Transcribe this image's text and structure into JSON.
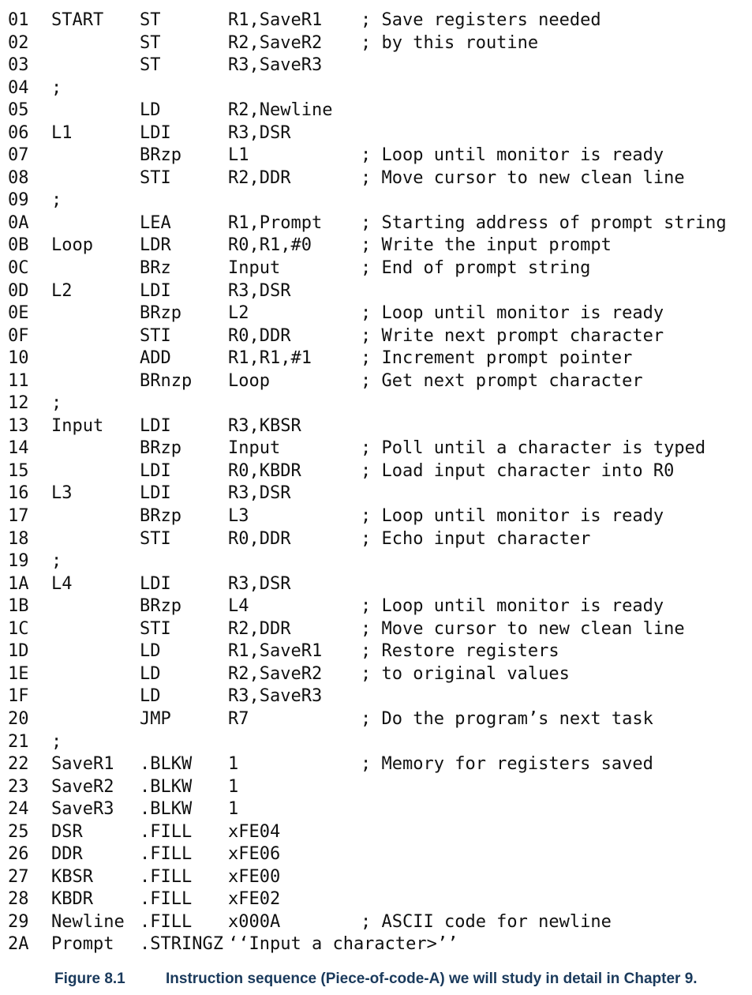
{
  "lines": [
    {
      "num": "01",
      "label": "START",
      "op": "ST",
      "operand": "R1,SaveR1",
      "comment": "; Save registers needed"
    },
    {
      "num": "02",
      "label": "",
      "op": "ST",
      "operand": "R2,SaveR2",
      "comment": "; by this routine"
    },
    {
      "num": "03",
      "label": "",
      "op": "ST",
      "operand": "R3,SaveR3",
      "comment": ""
    },
    {
      "num": "04",
      "label": ";",
      "op": "",
      "operand": "",
      "comment": ""
    },
    {
      "num": "05",
      "label": "",
      "op": "LD",
      "operand": "R2,Newline",
      "comment": ""
    },
    {
      "num": "06",
      "label": "L1",
      "op": "LDI",
      "operand": "R3,DSR",
      "comment": ""
    },
    {
      "num": "07",
      "label": "",
      "op": "BRzp",
      "operand": "L1",
      "comment": "; Loop until monitor is ready"
    },
    {
      "num": "08",
      "label": "",
      "op": "STI",
      "operand": "R2,DDR",
      "comment": "; Move cursor to new clean line"
    },
    {
      "num": "09",
      "label": ";",
      "op": "",
      "operand": "",
      "comment": ""
    },
    {
      "num": "0A",
      "label": "",
      "op": "LEA",
      "operand": "R1,Prompt",
      "comment": "; Starting address of prompt string"
    },
    {
      "num": "0B",
      "label": "Loop",
      "op": "LDR",
      "operand": "R0,R1,#0",
      "comment": "; Write the input prompt"
    },
    {
      "num": "0C",
      "label": "",
      "op": "BRz",
      "operand": "Input",
      "comment": "; End of prompt string"
    },
    {
      "num": "0D",
      "label": "L2",
      "op": "LDI",
      "operand": "R3,DSR",
      "comment": ""
    },
    {
      "num": "0E",
      "label": "",
      "op": "BRzp",
      "operand": "L2",
      "comment": "; Loop until monitor is ready"
    },
    {
      "num": "0F",
      "label": "",
      "op": "STI",
      "operand": "R0,DDR",
      "comment": "; Write next prompt character"
    },
    {
      "num": "10",
      "label": "",
      "op": "ADD",
      "operand": "R1,R1,#1",
      "comment": "; Increment prompt pointer"
    },
    {
      "num": "11",
      "label": "",
      "op": "BRnzp",
      "operand": "Loop",
      "comment": "; Get next prompt character"
    },
    {
      "num": "12",
      "label": ";",
      "op": "",
      "operand": "",
      "comment": ""
    },
    {
      "num": "13",
      "label": "Input",
      "op": "LDI",
      "operand": "R3,KBSR",
      "comment": ""
    },
    {
      "num": "14",
      "label": "",
      "op": "BRzp",
      "operand": "Input",
      "comment": "; Poll until a character is typed"
    },
    {
      "num": "15",
      "label": "",
      "op": "LDI",
      "operand": "R0,KBDR",
      "comment": "; Load input character into R0"
    },
    {
      "num": "16",
      "label": "L3",
      "op": "LDI",
      "operand": "R3,DSR",
      "comment": ""
    },
    {
      "num": "17",
      "label": "",
      "op": "BRzp",
      "operand": "L3",
      "comment": "; Loop until monitor is ready"
    },
    {
      "num": "18",
      "label": "",
      "op": "STI",
      "operand": "R0,DDR",
      "comment": "; Echo input character"
    },
    {
      "num": "19",
      "label": ";",
      "op": "",
      "operand": "",
      "comment": ""
    },
    {
      "num": "1A",
      "label": "L4",
      "op": "LDI",
      "operand": "R3,DSR",
      "comment": ""
    },
    {
      "num": "1B",
      "label": "",
      "op": "BRzp",
      "operand": "L4",
      "comment": "; Loop until monitor is ready"
    },
    {
      "num": "1C",
      "label": "",
      "op": "STI",
      "operand": "R2,DDR",
      "comment": "; Move cursor to new clean line"
    },
    {
      "num": "1D",
      "label": "",
      "op": "LD",
      "operand": "R1,SaveR1",
      "comment": "; Restore registers"
    },
    {
      "num": "1E",
      "label": "",
      "op": "LD",
      "operand": "R2,SaveR2",
      "comment": "; to original values"
    },
    {
      "num": "1F",
      "label": "",
      "op": "LD",
      "operand": "R3,SaveR3",
      "comment": ""
    },
    {
      "num": "20",
      "label": "",
      "op": "JMP",
      "operand": "R7",
      "comment": "; Do the program’s next task"
    },
    {
      "num": "21",
      "label": ";",
      "op": "",
      "operand": "",
      "comment": ""
    },
    {
      "num": "22",
      "label": "SaveR1",
      "op": ".BLKW",
      "operand": "1",
      "comment": "; Memory for registers saved"
    },
    {
      "num": "23",
      "label": "SaveR2",
      "op": ".BLKW",
      "operand": "1",
      "comment": ""
    },
    {
      "num": "24",
      "label": "SaveR3",
      "op": ".BLKW",
      "operand": "1",
      "comment": ""
    },
    {
      "num": "25",
      "label": "DSR",
      "op": ".FILL",
      "operand": "xFE04",
      "comment": ""
    },
    {
      "num": "26",
      "label": "DDR",
      "op": ".FILL",
      "operand": "xFE06",
      "comment": ""
    },
    {
      "num": "27",
      "label": "KBSR",
      "op": ".FILL",
      "operand": "xFE00",
      "comment": ""
    },
    {
      "num": "28",
      "label": "KBDR",
      "op": ".FILL",
      "operand": "xFE02",
      "comment": ""
    },
    {
      "num": "29",
      "label": "Newline",
      "op": ".FILL",
      "operand": "x000A",
      "comment": "; ASCII code for newline"
    },
    {
      "num": "2A",
      "label": "Prompt",
      "op": ".STRINGZ",
      "operand": "‘‘Input a character>’’",
      "comment": ""
    }
  ],
  "caption": {
    "number": "Figure 8.1",
    "text": "Instruction sequence (Piece-of-code-A) we will study in detail in Chapter 9."
  }
}
